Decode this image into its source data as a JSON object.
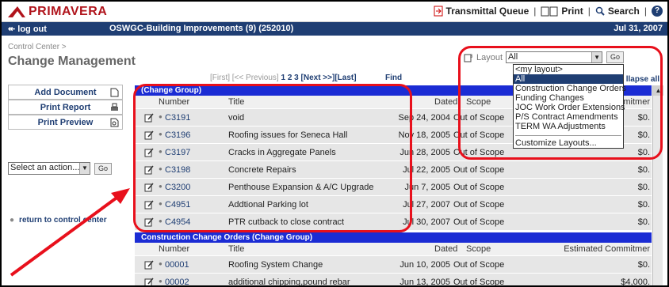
{
  "app": {
    "logo_text": "PRIMAVERA",
    "transmittal": "Transmittal Queue",
    "print": "Print",
    "search": "Search",
    "help_glyph": "?"
  },
  "nav": {
    "logout": "log out",
    "project": "OSWGC-Building Improvements (9) (252010)",
    "date": "Jul 31, 2007"
  },
  "page": {
    "breadcrumb": "Control Center >",
    "title": "Change Management"
  },
  "layout": {
    "label": "Layout",
    "selected": "All",
    "go": "Go",
    "options": [
      "<my layout>",
      "All",
      "Construction Change Orders",
      "Funding Changes",
      "JOC Work Order Extensions",
      "P/S Contract Amendments",
      "TERM WA Adjustments",
      "Customize Layouts..."
    ]
  },
  "pager": {
    "first": "[First]",
    "prev": "[<< Previous]",
    "p1": "1",
    "p2": "2",
    "p3": "3",
    "next": "[Next >>]",
    "last": "[Last]",
    "find": "Find",
    "collapse": "llapse all"
  },
  "sidebar": {
    "add_document": "Add Document",
    "print_report": "Print Report",
    "print_preview": "Print Preview",
    "action_placeholder": "Select an action...",
    "action_go": "Go",
    "return": "return to control center"
  },
  "table": {
    "headers": {
      "number": "Number",
      "title": "Title",
      "dated": "Dated",
      "scope": "Scope",
      "amount": "mitmer",
      "amount2": "Estimated Commitmer"
    },
    "group1": "(Change Group)",
    "group2": "Construction Change Orders (Change Group)",
    "rows1": [
      {
        "number": "C3191",
        "title": "void",
        "dated": "Sep 24, 2004",
        "scope": "Out of Scope",
        "amount": "$0."
      },
      {
        "number": "C3196",
        "title": "Roofing issues for Seneca Hall",
        "dated": "Nov 18, 2005",
        "scope": "Out of Scope",
        "amount": "$0."
      },
      {
        "number": "C3197",
        "title": "Cracks in Aggregate Panels",
        "dated": "Jun 28, 2005",
        "scope": "Out of Scope",
        "amount": "$0."
      },
      {
        "number": "C3198",
        "title": "Concrete Repairs",
        "dated": "Jul 22, 2005",
        "scope": "Out of Scope",
        "amount": "$0."
      },
      {
        "number": "C3200",
        "title": "Penthouse Expansion & A/C Upgrade",
        "dated": "Jun 7, 2005",
        "scope": "Out of Scope",
        "amount": "$0."
      },
      {
        "number": "C4951",
        "title": "Addtional Parking lot",
        "dated": "Jul 27, 2007",
        "scope": "Out of Scope",
        "amount": "$0."
      },
      {
        "number": "C4954",
        "title": "PTR cutback to close contract",
        "dated": "Jul 30, 2007",
        "scope": "Out of Scope",
        "amount": "$0."
      }
    ],
    "rows2": [
      {
        "number": "00001",
        "title": "Roofing System Change",
        "dated": "Jun 10, 2005",
        "scope": "Out of Scope",
        "amount": "$0."
      },
      {
        "number": "00002",
        "title": "additional chipping,pound rebar",
        "dated": "Jun 13, 2005",
        "scope": "Out of Scope",
        "amount": "$4,000."
      }
    ]
  },
  "colors": {
    "nav": "#1f3e73",
    "group_bar": "#1b2cd4",
    "annotation": "#e8101c",
    "brand": "#b0141c"
  }
}
